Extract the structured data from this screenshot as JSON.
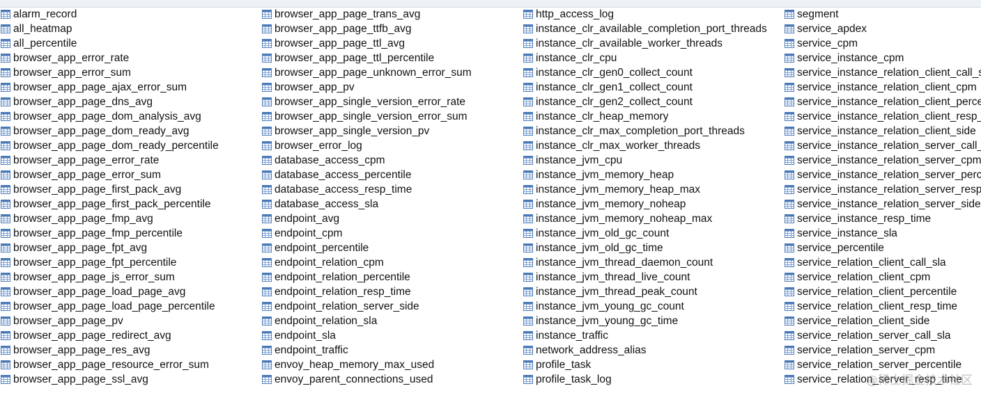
{
  "columns": [
    {
      "items": [
        "alarm_record",
        "all_heatmap",
        "all_percentile",
        "browser_app_error_rate",
        "browser_app_error_sum",
        "browser_app_page_ajax_error_sum",
        "browser_app_page_dns_avg",
        "browser_app_page_dom_analysis_avg",
        "browser_app_page_dom_ready_avg",
        "browser_app_page_dom_ready_percentile",
        "browser_app_page_error_rate",
        "browser_app_page_error_sum",
        "browser_app_page_first_pack_avg",
        "browser_app_page_first_pack_percentile",
        "browser_app_page_fmp_avg",
        "browser_app_page_fmp_percentile",
        "browser_app_page_fpt_avg",
        "browser_app_page_fpt_percentile",
        "browser_app_page_js_error_sum",
        "browser_app_page_load_page_avg",
        "browser_app_page_load_page_percentile",
        "browser_app_page_pv",
        "browser_app_page_redirect_avg",
        "browser_app_page_res_avg",
        "browser_app_page_resource_error_sum",
        "browser_app_page_ssl_avg"
      ]
    },
    {
      "items": [
        "browser_app_page_trans_avg",
        "browser_app_page_ttfb_avg",
        "browser_app_page_ttl_avg",
        "browser_app_page_ttl_percentile",
        "browser_app_page_unknown_error_sum",
        "browser_app_pv",
        "browser_app_single_version_error_rate",
        "browser_app_single_version_error_sum",
        "browser_app_single_version_pv",
        "browser_error_log",
        "database_access_cpm",
        "database_access_percentile",
        "database_access_resp_time",
        "database_access_sla",
        "endpoint_avg",
        "endpoint_cpm",
        "endpoint_percentile",
        "endpoint_relation_cpm",
        "endpoint_relation_percentile",
        "endpoint_relation_resp_time",
        "endpoint_relation_server_side",
        "endpoint_relation_sla",
        "endpoint_sla",
        "endpoint_traffic",
        "envoy_heap_memory_max_used",
        "envoy_parent_connections_used"
      ]
    },
    {
      "items": [
        "http_access_log",
        "instance_clr_available_completion_port_threads",
        "instance_clr_available_worker_threads",
        "instance_clr_cpu",
        "instance_clr_gen0_collect_count",
        "instance_clr_gen1_collect_count",
        "instance_clr_gen2_collect_count",
        "instance_clr_heap_memory",
        "instance_clr_max_completion_port_threads",
        "instance_clr_max_worker_threads",
        "instance_jvm_cpu",
        "instance_jvm_memory_heap",
        "instance_jvm_memory_heap_max",
        "instance_jvm_memory_noheap",
        "instance_jvm_memory_noheap_max",
        "instance_jvm_old_gc_count",
        "instance_jvm_old_gc_time",
        "instance_jvm_thread_daemon_count",
        "instance_jvm_thread_live_count",
        "instance_jvm_thread_peak_count",
        "instance_jvm_young_gc_count",
        "instance_jvm_young_gc_time",
        "instance_traffic",
        "network_address_alias",
        "profile_task",
        "profile_task_log"
      ]
    },
    {
      "items": [
        "segment",
        "service_apdex",
        "service_cpm",
        "service_instance_cpm",
        "service_instance_relation_client_call_sla",
        "service_instance_relation_client_cpm",
        "service_instance_relation_client_percentile",
        "service_instance_relation_client_resp_time",
        "service_instance_relation_client_side",
        "service_instance_relation_server_call_sla",
        "service_instance_relation_server_cpm",
        "service_instance_relation_server_percentile",
        "service_instance_relation_server_resp_time",
        "service_instance_relation_server_side",
        "service_instance_resp_time",
        "service_instance_sla",
        "service_percentile",
        "service_relation_client_call_sla",
        "service_relation_client_cpm",
        "service_relation_client_percentile",
        "service_relation_client_resp_time",
        "service_relation_client_side",
        "service_relation_server_call_sla",
        "service_relation_server_cpm",
        "service_relation_server_percentile",
        "service_relation_server_resp_time"
      ]
    }
  ],
  "watermark": "@稀土掘金技术社区",
  "icon_name": "table-icon"
}
